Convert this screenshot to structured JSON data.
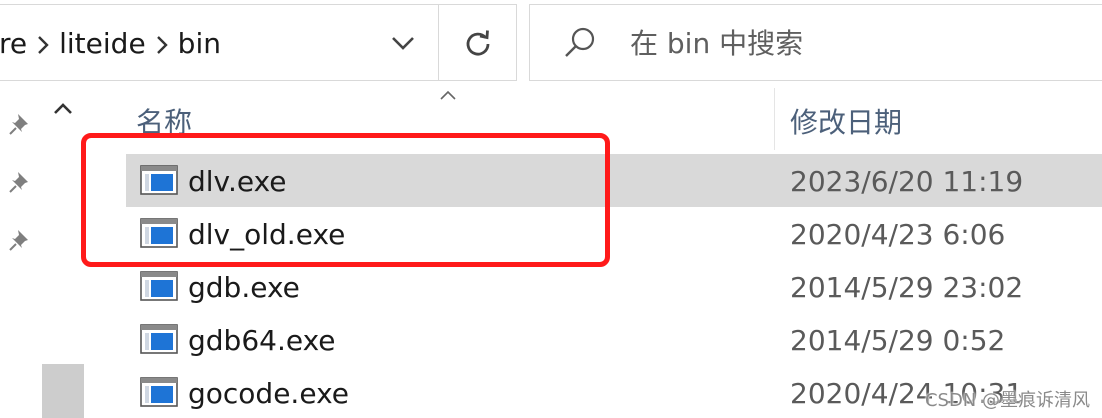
{
  "address_bar": {
    "crumbs": [
      "re",
      "liteide",
      "bin"
    ]
  },
  "search": {
    "placeholder": "在 bin 中搜索"
  },
  "columns": {
    "name": "名称",
    "date_modified": "修改日期"
  },
  "files": [
    {
      "name": "dlv.exe",
      "date": "2023/6/20 11:19",
      "selected": true
    },
    {
      "name": "dlv_old.exe",
      "date": "2020/4/23 6:06",
      "selected": false
    },
    {
      "name": "gdb.exe",
      "date": "2014/5/29 23:02",
      "selected": false
    },
    {
      "name": "gdb64.exe",
      "date": "2014/5/29 0:52",
      "selected": false
    },
    {
      "name": "gocode.exe",
      "date": "2020/4/24 10:31",
      "selected": false
    }
  ],
  "watermark": "CSDN @墨痕诉清风",
  "colors": {
    "highlight": "#ff1a1a",
    "selection": "#d9d9d9",
    "exe_icon_blue": "#1e74d6"
  }
}
